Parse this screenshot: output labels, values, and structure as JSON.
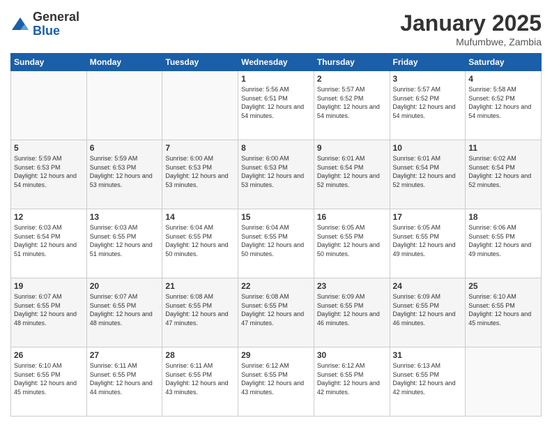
{
  "header": {
    "logo_general": "General",
    "logo_blue": "Blue",
    "month_title": "January 2025",
    "location": "Mufumbwe, Zambia"
  },
  "weekdays": [
    "Sunday",
    "Monday",
    "Tuesday",
    "Wednesday",
    "Thursday",
    "Friday",
    "Saturday"
  ],
  "weeks": [
    [
      {
        "day": "",
        "info": ""
      },
      {
        "day": "",
        "info": ""
      },
      {
        "day": "",
        "info": ""
      },
      {
        "day": "1",
        "info": "Sunrise: 5:56 AM\nSunset: 6:51 PM\nDaylight: 12 hours\nand 54 minutes."
      },
      {
        "day": "2",
        "info": "Sunrise: 5:57 AM\nSunset: 6:52 PM\nDaylight: 12 hours\nand 54 minutes."
      },
      {
        "day": "3",
        "info": "Sunrise: 5:57 AM\nSunset: 6:52 PM\nDaylight: 12 hours\nand 54 minutes."
      },
      {
        "day": "4",
        "info": "Sunrise: 5:58 AM\nSunset: 6:52 PM\nDaylight: 12 hours\nand 54 minutes."
      }
    ],
    [
      {
        "day": "5",
        "info": "Sunrise: 5:59 AM\nSunset: 6:53 PM\nDaylight: 12 hours\nand 54 minutes."
      },
      {
        "day": "6",
        "info": "Sunrise: 5:59 AM\nSunset: 6:53 PM\nDaylight: 12 hours\nand 53 minutes."
      },
      {
        "day": "7",
        "info": "Sunrise: 6:00 AM\nSunset: 6:53 PM\nDaylight: 12 hours\nand 53 minutes."
      },
      {
        "day": "8",
        "info": "Sunrise: 6:00 AM\nSunset: 6:53 PM\nDaylight: 12 hours\nand 53 minutes."
      },
      {
        "day": "9",
        "info": "Sunrise: 6:01 AM\nSunset: 6:54 PM\nDaylight: 12 hours\nand 52 minutes."
      },
      {
        "day": "10",
        "info": "Sunrise: 6:01 AM\nSunset: 6:54 PM\nDaylight: 12 hours\nand 52 minutes."
      },
      {
        "day": "11",
        "info": "Sunrise: 6:02 AM\nSunset: 6:54 PM\nDaylight: 12 hours\nand 52 minutes."
      }
    ],
    [
      {
        "day": "12",
        "info": "Sunrise: 6:03 AM\nSunset: 6:54 PM\nDaylight: 12 hours\nand 51 minutes."
      },
      {
        "day": "13",
        "info": "Sunrise: 6:03 AM\nSunset: 6:55 PM\nDaylight: 12 hours\nand 51 minutes."
      },
      {
        "day": "14",
        "info": "Sunrise: 6:04 AM\nSunset: 6:55 PM\nDaylight: 12 hours\nand 50 minutes."
      },
      {
        "day": "15",
        "info": "Sunrise: 6:04 AM\nSunset: 6:55 PM\nDaylight: 12 hours\nand 50 minutes."
      },
      {
        "day": "16",
        "info": "Sunrise: 6:05 AM\nSunset: 6:55 PM\nDaylight: 12 hours\nand 50 minutes."
      },
      {
        "day": "17",
        "info": "Sunrise: 6:05 AM\nSunset: 6:55 PM\nDaylight: 12 hours\nand 49 minutes."
      },
      {
        "day": "18",
        "info": "Sunrise: 6:06 AM\nSunset: 6:55 PM\nDaylight: 12 hours\nand 49 minutes."
      }
    ],
    [
      {
        "day": "19",
        "info": "Sunrise: 6:07 AM\nSunset: 6:55 PM\nDaylight: 12 hours\nand 48 minutes."
      },
      {
        "day": "20",
        "info": "Sunrise: 6:07 AM\nSunset: 6:55 PM\nDaylight: 12 hours\nand 48 minutes."
      },
      {
        "day": "21",
        "info": "Sunrise: 6:08 AM\nSunset: 6:55 PM\nDaylight: 12 hours\nand 47 minutes."
      },
      {
        "day": "22",
        "info": "Sunrise: 6:08 AM\nSunset: 6:55 PM\nDaylight: 12 hours\nand 47 minutes."
      },
      {
        "day": "23",
        "info": "Sunrise: 6:09 AM\nSunset: 6:55 PM\nDaylight: 12 hours\nand 46 minutes."
      },
      {
        "day": "24",
        "info": "Sunrise: 6:09 AM\nSunset: 6:55 PM\nDaylight: 12 hours\nand 46 minutes."
      },
      {
        "day": "25",
        "info": "Sunrise: 6:10 AM\nSunset: 6:55 PM\nDaylight: 12 hours\nand 45 minutes."
      }
    ],
    [
      {
        "day": "26",
        "info": "Sunrise: 6:10 AM\nSunset: 6:55 PM\nDaylight: 12 hours\nand 45 minutes."
      },
      {
        "day": "27",
        "info": "Sunrise: 6:11 AM\nSunset: 6:55 PM\nDaylight: 12 hours\nand 44 minutes."
      },
      {
        "day": "28",
        "info": "Sunrise: 6:11 AM\nSunset: 6:55 PM\nDaylight: 12 hours\nand 43 minutes."
      },
      {
        "day": "29",
        "info": "Sunrise: 6:12 AM\nSunset: 6:55 PM\nDaylight: 12 hours\nand 43 minutes."
      },
      {
        "day": "30",
        "info": "Sunrise: 6:12 AM\nSunset: 6:55 PM\nDaylight: 12 hours\nand 42 minutes."
      },
      {
        "day": "31",
        "info": "Sunrise: 6:13 AM\nSunset: 6:55 PM\nDaylight: 12 hours\nand 42 minutes."
      },
      {
        "day": "",
        "info": ""
      }
    ]
  ]
}
